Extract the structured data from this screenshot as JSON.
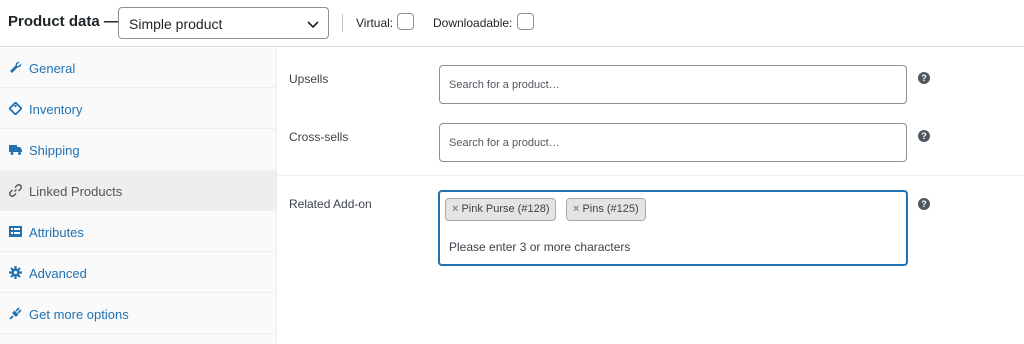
{
  "header": {
    "title": "Product data —",
    "product_type": "Simple product",
    "virtual_label": "Virtual:",
    "downloadable_label": "Downloadable:"
  },
  "sidebar": {
    "items": [
      {
        "label": "General",
        "icon": "wrench-icon"
      },
      {
        "label": "Inventory",
        "icon": "tag-icon"
      },
      {
        "label": "Shipping",
        "icon": "truck-icon"
      },
      {
        "label": "Linked Products",
        "icon": "link-icon",
        "active": true
      },
      {
        "label": "Attributes",
        "icon": "list-icon"
      },
      {
        "label": "Advanced",
        "icon": "gear-icon"
      },
      {
        "label": "Get more options",
        "icon": "plugin-icon"
      }
    ]
  },
  "fields": {
    "upsells": {
      "label": "Upsells",
      "placeholder": "Search for a product…"
    },
    "cross_sells": {
      "label": "Cross-sells",
      "placeholder": "Search for a product…"
    },
    "related_addon": {
      "label": "Related Add-on",
      "tokens": [
        "Pink Purse (#128)",
        "Pins (#125)"
      ],
      "remove_glyph": "×",
      "hint": "Please enter 3 or more characters"
    }
  },
  "help_glyph": "?",
  "colors": {
    "link": "#2271b1",
    "focus_border": "#2271b1"
  }
}
